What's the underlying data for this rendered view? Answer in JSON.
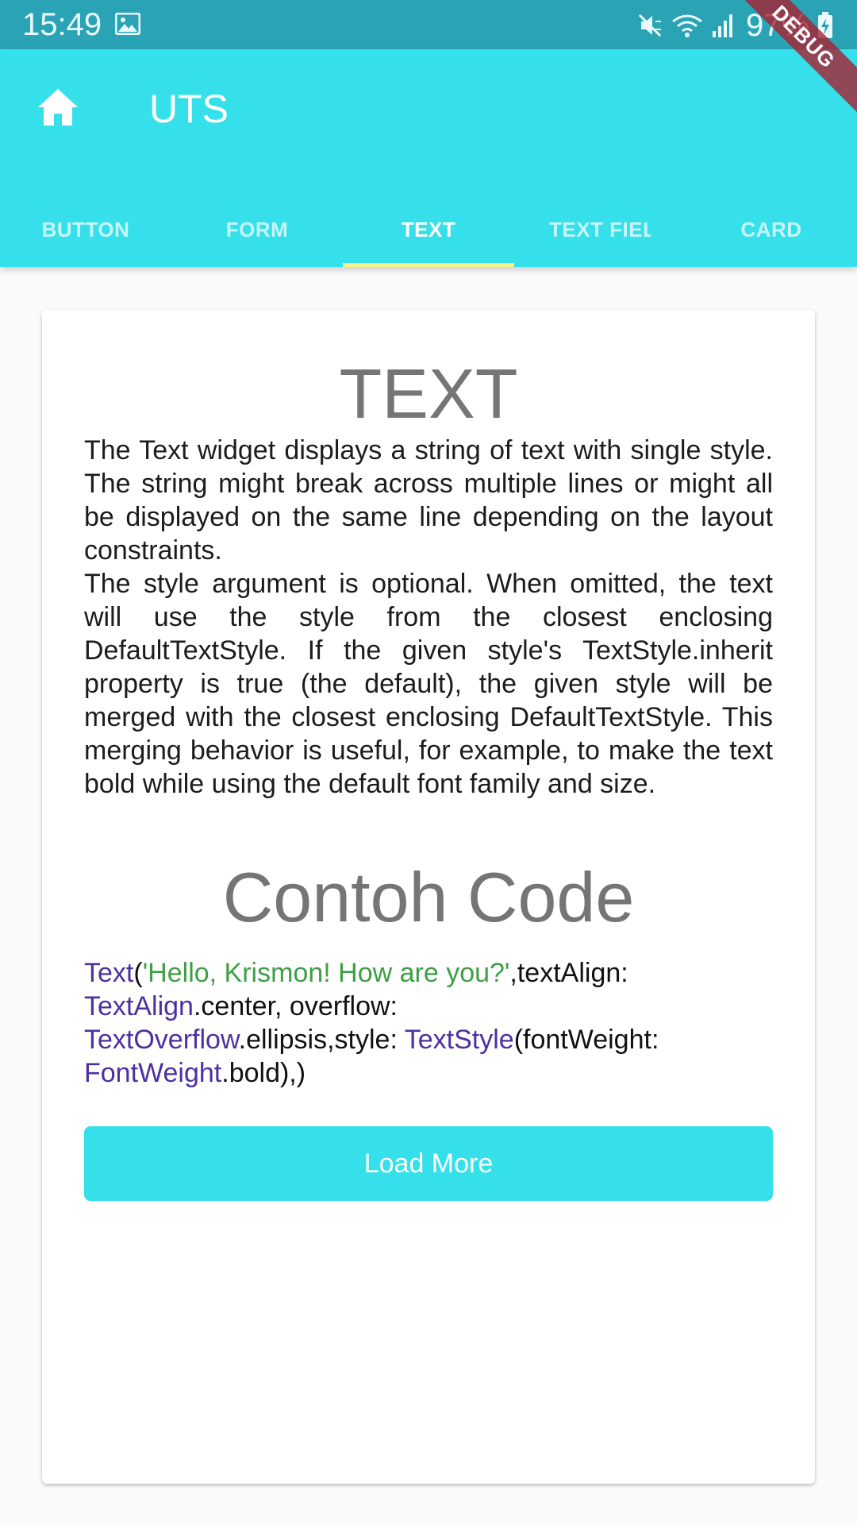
{
  "status_bar": {
    "time": "15:49",
    "battery": "97%",
    "icons": [
      "image-icon",
      "mute-icon",
      "wifi-icon",
      "signal-icon",
      "battery-charging-icon"
    ]
  },
  "debug_banner": "DEBUG",
  "app_bar": {
    "title": "UTS",
    "home_icon": "home-icon",
    "background_color": "#35e0ea",
    "indicator_color": "#f3f58a"
  },
  "tabs": [
    {
      "label": "BUTTON",
      "active": false
    },
    {
      "label": "FORM",
      "active": false
    },
    {
      "label": "TEXT",
      "active": true
    },
    {
      "label": "TEXT FIELD",
      "active": false
    },
    {
      "label": "CARD",
      "active": false
    }
  ],
  "card": {
    "title": "TEXT",
    "paragraphs": [
      "The Text widget displays a string of text with single style. The string might break across multiple lines or might all be displayed on the same line depending on the layout constraints.",
      "The style argument is optional. When omitted, the text will use the style from the closest enclosing DefaultTextStyle. If the given style's TextStyle.inherit property is true (the default), the given style will be merged with the closest enclosing DefaultTextStyle. This merging behavior is useful, for example, to make the text bold while using the default font family and size."
    ],
    "code_title": "Contoh Code",
    "code": {
      "line1": {
        "a": "Text",
        "b": "(",
        "c": "'Hello, Krismon! How are you?'",
        "d": ",textAlign:"
      },
      "line2": {
        "a": "TextAlign",
        "b": ".center, overflow:"
      },
      "line3": {
        "a": "TextOverflow",
        "b": ".ellipsis,style: ",
        "c": "TextStyle",
        "d": "(fontWeight:"
      },
      "line4": {
        "a": "FontWeight",
        "b": ".bold),)"
      }
    },
    "button_label": "Load More"
  }
}
